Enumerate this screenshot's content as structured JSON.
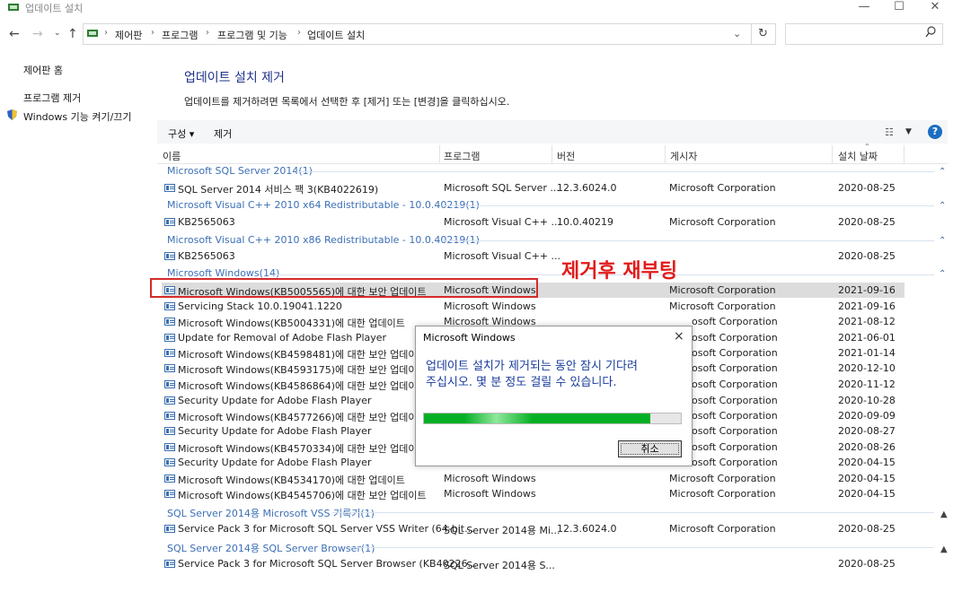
{
  "window": {
    "title": "업데이트 설치"
  },
  "address": {
    "crumbs": [
      "제어판",
      "프로그램",
      "프로그램 및 기능",
      "업데이트 설치"
    ],
    "search_placeholder": ""
  },
  "left_pane": {
    "home": "제어판 홈",
    "uninstall": "프로그램 제거",
    "features": "Windows 기능 켜기/끄기"
  },
  "main": {
    "title": "업데이트 설치 제거",
    "description": "업데이트를 제거하려면 목록에서 선택한 후 [제거] 또는 [변경]을 클릭하십시오."
  },
  "toolbar": {
    "organize": "구성 ▾",
    "remove": "제거",
    "help": "?"
  },
  "columns": {
    "name": "이름",
    "program": "프로그램",
    "version": "버전",
    "publisher": "게시자",
    "installed": "설치 날짜"
  },
  "groups": [
    {
      "label": "Microsoft SQL Server 2014(1)"
    },
    {
      "label": "Microsoft Visual C++ 2010  x64 Redistributable - 10.0.40219(1)"
    },
    {
      "label": "Microsoft Visual C++ 2010  x86 Redistributable - 10.0.40219(1)"
    },
    {
      "label": "Microsoft Windows(14)"
    },
    {
      "label": "SQL Server 2014용 Microsoft VSS 기록기(1)"
    },
    {
      "label": "SQL Server 2014용 SQL Server Browser(1)"
    }
  ],
  "rows": [
    {
      "name": "SQL Server 2014 서비스 팩 3(KB4022619)",
      "program": "Microsoft SQL Server ...",
      "version": "12.3.6024.0",
      "publisher": "Microsoft Corporation",
      "date": "2020-08-25"
    },
    {
      "name": "KB2565063",
      "program": "Microsoft Visual C++ ...",
      "version": "10.0.40219",
      "publisher": "Microsoft Corporation",
      "date": "2020-08-25"
    },
    {
      "name": "KB2565063",
      "program": "Microsoft Visual C++ ...",
      "version": "",
      "publisher": "",
      "date": "2020-08-25"
    },
    {
      "name": "Microsoft Windows(KB5005565)에 대한 보안 업데이트",
      "program": "Microsoft Windows",
      "version": "",
      "publisher": "Microsoft Corporation",
      "date": "2021-09-16"
    },
    {
      "name": "Servicing Stack 10.0.19041.1220",
      "program": "Microsoft Windows",
      "version": "",
      "publisher": "Microsoft Corporation",
      "date": "2021-09-16"
    },
    {
      "name": "Microsoft Windows(KB5004331)에 대한 업데이트",
      "program": "Microsoft Windows",
      "version": "",
      "publisher": "osoft Corporation",
      "date": "2021-08-12"
    },
    {
      "name": "Update for Removal of Adobe Flash Player",
      "program": "",
      "version": "",
      "publisher": "osoft Corporation",
      "date": "2021-06-01"
    },
    {
      "name": "Microsoft Windows(KB4598481)에 대한 보안 업데이트",
      "program": "",
      "version": "",
      "publisher": "osoft Corporation",
      "date": "2021-01-14"
    },
    {
      "name": "Microsoft Windows(KB4593175)에 대한 보안 업데이트",
      "program": "",
      "version": "",
      "publisher": "osoft Corporation",
      "date": "2020-12-10"
    },
    {
      "name": "Microsoft Windows(KB4586864)에 대한 보안 업데이트",
      "program": "",
      "version": "",
      "publisher": "osoft Corporation",
      "date": "2020-11-12"
    },
    {
      "name": "Security Update for Adobe Flash Player",
      "program": "",
      "version": "",
      "publisher": "osoft Corporation",
      "date": "2020-10-28"
    },
    {
      "name": "Microsoft Windows(KB4577266)에 대한 보안 업데이트",
      "program": "",
      "version": "",
      "publisher": "osoft Corporation",
      "date": "2020-09-09"
    },
    {
      "name": "Security Update for Adobe Flash Player",
      "program": "",
      "version": "",
      "publisher": "osoft Corporation",
      "date": "2020-08-27"
    },
    {
      "name": "Microsoft Windows(KB4570334)에 대한 보안 업데이트",
      "program": "",
      "version": "",
      "publisher": "osoft Corporation",
      "date": "2020-08-26"
    },
    {
      "name": "Security Update for Adobe Flash Player",
      "program": "",
      "version": "",
      "publisher": "osoft Corporation",
      "date": "2020-04-15"
    },
    {
      "name": "Microsoft Windows(KB4534170)에 대한 업데이트",
      "program": "Microsoft Windows",
      "version": "",
      "publisher": "Microsoft Corporation",
      "date": "2020-04-15"
    },
    {
      "name": "Microsoft Windows(KB4545706)에 대한 보안 업데이트",
      "program": "Microsoft Windows",
      "version": "",
      "publisher": "Microsoft Corporation",
      "date": "2020-04-15"
    },
    {
      "name": "Service Pack 3 for Microsoft SQL Server VSS Writer (64-bit...",
      "program": "SQL Server 2014용 Mi...",
      "version": "12.3.6024.0",
      "publisher": "Microsoft Corporation",
      "date": "2020-08-25"
    },
    {
      "name": "Service Pack 3 for Microsoft SQL Server Browser (KB40226...",
      "program": "SQL Server 2014용 S...",
      "version": "",
      "publisher": "",
      "date": "2020-08-25"
    }
  ],
  "dialog": {
    "title": "Microsoft Windows",
    "close": "×",
    "message_line1": "업데이트 설치가 제거되는 동안 잠시 기다려",
    "message_line2": "주십시오. 몇 분 정도 걸릴 수 있습니다.",
    "progress": 0.88,
    "cancel": "취소"
  },
  "annotation": {
    "text": "제거후 재부팅",
    "color": "#e21b1b"
  },
  "colors": {
    "accent": "#1e3287",
    "group": "#3c6fb6",
    "progress": "#06b025"
  }
}
